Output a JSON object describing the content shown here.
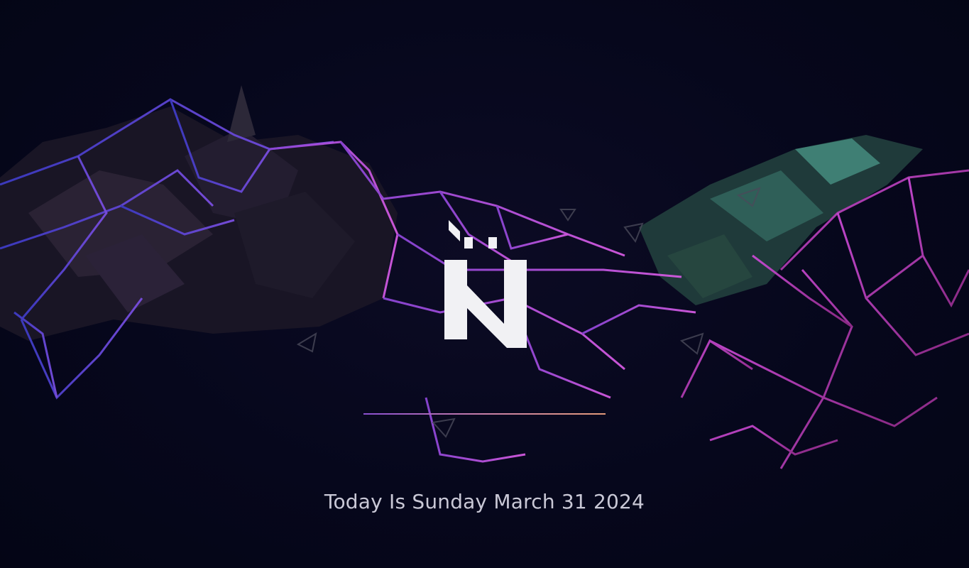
{
  "lock_screen": {
    "logo_icon": "n-brand-logo-icon",
    "date_text": "Today Is Sunday March 31 2024",
    "colors": {
      "background": "#05061a",
      "text": "#c9c8d6",
      "divider_start": "#8a4fd0",
      "divider_end": "#e39a7a",
      "wireframe_blue": "#5b4be0",
      "wireframe_purple": "#b35ae6",
      "wireframe_magenta": "#e052c8",
      "shard_teal": "#3f7f74"
    }
  }
}
